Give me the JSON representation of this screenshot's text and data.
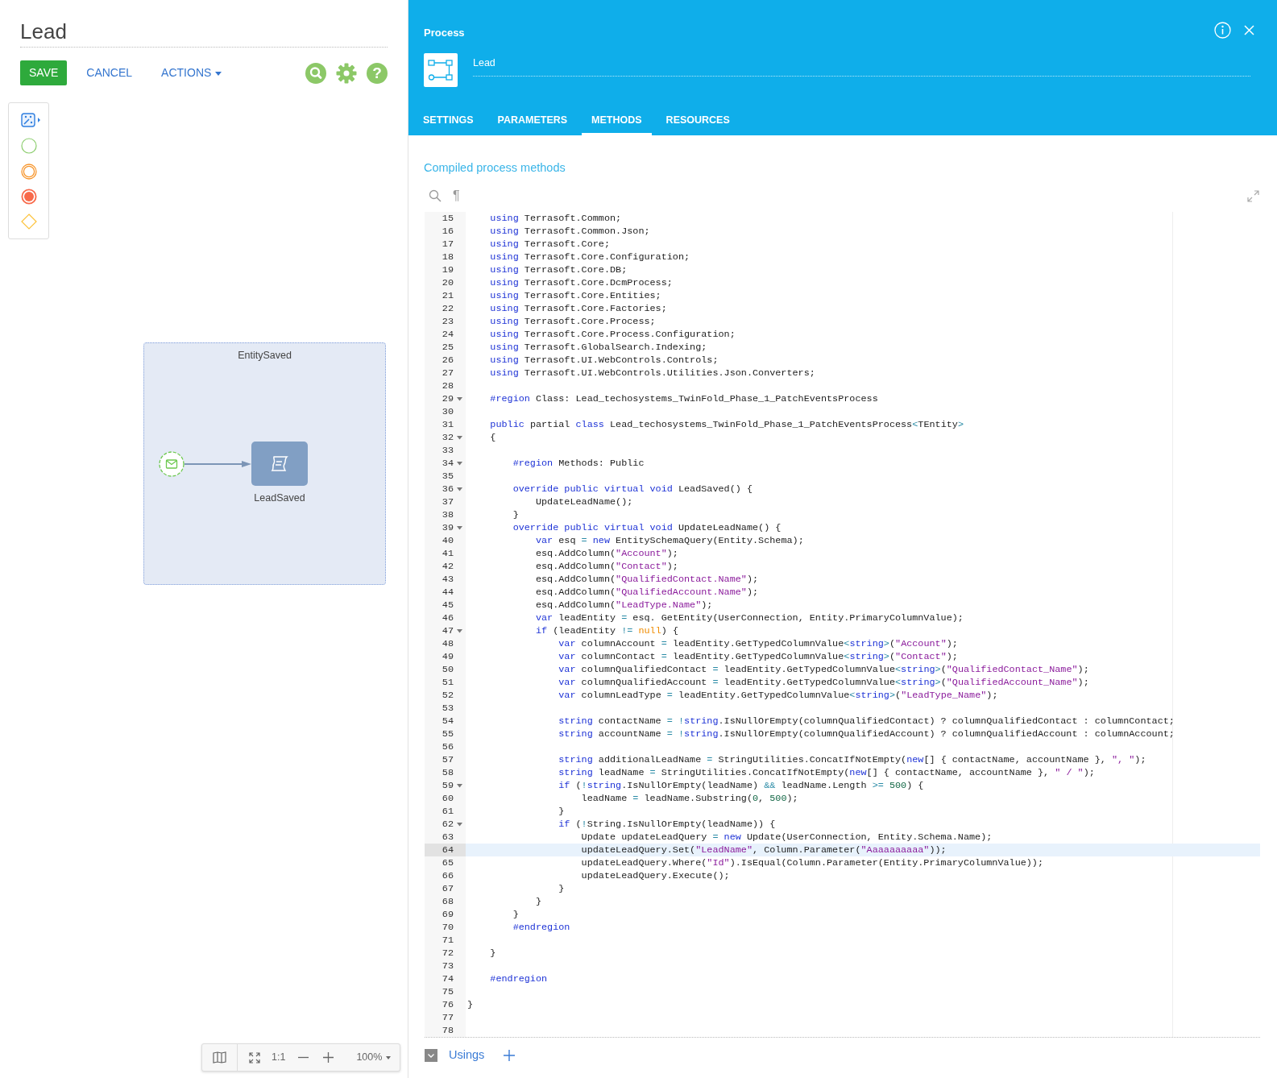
{
  "page": {
    "title": "Lead"
  },
  "toolbar": {
    "buttons": [
      {
        "label": "SAVE",
        "kind": "primary"
      },
      {
        "label": "CANCEL",
        "kind": "link"
      },
      {
        "label": "ACTIONS",
        "kind": "dropdown"
      }
    ],
    "help": "?"
  },
  "diagram": {
    "lane": {
      "label": "EntitySaved"
    },
    "task": {
      "label": "LeadSaved"
    }
  },
  "zoom_bar": {
    "actual_size": "1:1",
    "zoom": "100%"
  },
  "process_panel": {
    "title": "Process",
    "name": "Lead",
    "tabs": [
      {
        "label": "SETTINGS",
        "selected": false
      },
      {
        "label": "PARAMETERS",
        "selected": false
      },
      {
        "label": "METHODS",
        "selected": true
      },
      {
        "label": "RESOURCES",
        "selected": false
      }
    ],
    "section_title": "Compiled process methods",
    "format_marks": "¶",
    "editor": {
      "lines": [
        {
          "num": "15",
          "foldable": false,
          "current": false,
          "parts": [
            {
              "kind": "keyword",
              "text": "    using"
            },
            {
              "kind": "plain",
              "text": " Terrasoft.Common;"
            }
          ]
        },
        {
          "num": "16",
          "foldable": false,
          "current": false,
          "parts": [
            {
              "kind": "keyword",
              "text": "    using"
            },
            {
              "kind": "plain",
              "text": " Terrasoft.Common.Json;"
            }
          ]
        },
        {
          "num": "17",
          "foldable": false,
          "current": false,
          "parts": [
            {
              "kind": "keyword",
              "text": "    using"
            },
            {
              "kind": "plain",
              "text": " Terrasoft.Core;"
            }
          ]
        },
        {
          "num": "18",
          "foldable": false,
          "current": false,
          "parts": [
            {
              "kind": "keyword",
              "text": "    using"
            },
            {
              "kind": "plain",
              "text": " Terrasoft.Core.Configuration;"
            }
          ]
        },
        {
          "num": "19",
          "foldable": false,
          "current": false,
          "parts": [
            {
              "kind": "keyword",
              "text": "    using"
            },
            {
              "kind": "plain",
              "text": " Terrasoft.Core.DB;"
            }
          ]
        },
        {
          "num": "20",
          "foldable": false,
          "current": false,
          "parts": [
            {
              "kind": "keyword",
              "text": "    using"
            },
            {
              "kind": "plain",
              "text": " Terrasoft.Core.DcmProcess;"
            }
          ]
        },
        {
          "num": "21",
          "foldable": false,
          "current": false,
          "parts": [
            {
              "kind": "keyword",
              "text": "    using"
            },
            {
              "kind": "plain",
              "text": " Terrasoft.Core.Entities;"
            }
          ]
        },
        {
          "num": "22",
          "foldable": false,
          "current": false,
          "parts": [
            {
              "kind": "keyword",
              "text": "    using"
            },
            {
              "kind": "plain",
              "text": " Terrasoft.Core.Factories;"
            }
          ]
        },
        {
          "num": "23",
          "foldable": false,
          "current": false,
          "parts": [
            {
              "kind": "keyword",
              "text": "    using"
            },
            {
              "kind": "plain",
              "text": " Terrasoft.Core.Process;"
            }
          ]
        },
        {
          "num": "24",
          "foldable": false,
          "current": false,
          "parts": [
            {
              "kind": "keyword",
              "text": "    using"
            },
            {
              "kind": "plain",
              "text": " Terrasoft.Core.Process.Configuration;"
            }
          ]
        },
        {
          "num": "25",
          "foldable": false,
          "current": false,
          "parts": [
            {
              "kind": "keyword",
              "text": "    using"
            },
            {
              "kind": "plain",
              "text": " Terrasoft.GlobalSearch.Indexing;"
            }
          ]
        },
        {
          "num": "26",
          "foldable": false,
          "current": false,
          "parts": [
            {
              "kind": "keyword",
              "text": "    using"
            },
            {
              "kind": "plain",
              "text": " Terrasoft.UI.WebControls.Controls;"
            }
          ]
        },
        {
          "num": "27",
          "foldable": false,
          "current": false,
          "parts": [
            {
              "kind": "keyword",
              "text": "    using"
            },
            {
              "kind": "plain",
              "text": " Terrasoft.UI.WebControls.Utilities.Json.Converters;"
            }
          ]
        },
        {
          "num": "28",
          "foldable": false,
          "current": false
        },
        {
          "num": "29",
          "foldable": true,
          "current": false,
          "parts": [
            {
              "kind": "keyword",
              "text": "    #region"
            },
            {
              "kind": "plain",
              "text": " Class: Lead_techosystems_TwinFold_Phase_1_PatchEventsProcess"
            }
          ]
        },
        {
          "num": "30",
          "foldable": false,
          "current": false
        },
        {
          "num": "31",
          "foldable": false,
          "current": false,
          "parts": [
            {
              "kind": "keyword",
              "text": "    public"
            },
            {
              "kind": "plain",
              "text": " partial "
            },
            {
              "kind": "keyword",
              "text": "class"
            },
            {
              "kind": "plain",
              "text": " Lead_techosystems_TwinFold_Phase_1_PatchEventsProcess"
            },
            {
              "kind": "operator",
              "text": "<"
            },
            {
              "kind": "plain",
              "text": "TEntity"
            },
            {
              "kind": "operator",
              "text": ">"
            }
          ]
        },
        {
          "num": "32",
          "foldable": true,
          "current": false,
          "parts": [
            {
              "kind": "plain",
              "text": "    {"
            }
          ]
        },
        {
          "num": "33",
          "foldable": false,
          "current": false
        },
        {
          "num": "34",
          "foldable": true,
          "current": false,
          "parts": [
            {
              "kind": "keyword",
              "text": "        #region"
            },
            {
              "kind": "plain",
              "text": " Methods: Public"
            }
          ]
        },
        {
          "num": "35",
          "foldable": false,
          "current": false
        },
        {
          "num": "36",
          "foldable": true,
          "current": false,
          "parts": [
            {
              "kind": "keyword",
              "text": "        override public virtual void"
            },
            {
              "kind": "plain",
              "text": " LeadSaved() {"
            }
          ]
        },
        {
          "num": "37",
          "foldable": false,
          "current": false,
          "parts": [
            {
              "kind": "plain",
              "text": "            UpdateLeadName();"
            }
          ]
        },
        {
          "num": "38",
          "foldable": false,
          "current": false,
          "parts": [
            {
              "kind": "plain",
              "text": "        }"
            }
          ]
        },
        {
          "num": "39",
          "foldable": true,
          "current": false,
          "parts": [
            {
              "kind": "keyword",
              "text": "        override public virtual void"
            },
            {
              "kind": "plain",
              "text": " UpdateLeadName() {"
            }
          ]
        },
        {
          "num": "40",
          "foldable": false,
          "current": false,
          "parts": [
            {
              "kind": "keyword",
              "text": "            var"
            },
            {
              "kind": "plain",
              "text": " esq "
            },
            {
              "kind": "operator",
              "text": "="
            },
            {
              "kind": "keyword",
              "text": " new"
            },
            {
              "kind": "plain",
              "text": " EntitySchemaQuery(Entity.Schema);"
            }
          ]
        },
        {
          "num": "41",
          "foldable": false,
          "current": false,
          "parts": [
            {
              "kind": "plain",
              "text": "            esq.AddColumn("
            },
            {
              "kind": "string",
              "text": "\"Account\""
            },
            {
              "kind": "plain",
              "text": ");"
            }
          ]
        },
        {
          "num": "42",
          "foldable": false,
          "current": false,
          "parts": [
            {
              "kind": "plain",
              "text": "            esq.AddColumn("
            },
            {
              "kind": "string",
              "text": "\"Contact\""
            },
            {
              "kind": "plain",
              "text": ");"
            }
          ]
        },
        {
          "num": "43",
          "foldable": false,
          "current": false,
          "parts": [
            {
              "kind": "plain",
              "text": "            esq.AddColumn("
            },
            {
              "kind": "string",
              "text": "\"QualifiedContact.Name\""
            },
            {
              "kind": "plain",
              "text": ");"
            }
          ]
        },
        {
          "num": "44",
          "foldable": false,
          "current": false,
          "parts": [
            {
              "kind": "plain",
              "text": "            esq.AddColumn("
            },
            {
              "kind": "string",
              "text": "\"QualifiedAccount.Name\""
            },
            {
              "kind": "plain",
              "text": ");"
            }
          ]
        },
        {
          "num": "45",
          "foldable": false,
          "current": false,
          "parts": [
            {
              "kind": "plain",
              "text": "            esq.AddColumn("
            },
            {
              "kind": "string",
              "text": "\"LeadType.Name\""
            },
            {
              "kind": "plain",
              "text": ");"
            }
          ]
        },
        {
          "num": "46",
          "foldable": false,
          "current": false,
          "parts": [
            {
              "kind": "keyword",
              "text": "            var"
            },
            {
              "kind": "plain",
              "text": " leadEntity "
            },
            {
              "kind": "operator",
              "text": "="
            },
            {
              "kind": "plain",
              "text": " esq. GetEntity(UserConnection, Entity.PrimaryColumnValue);"
            }
          ]
        },
        {
          "num": "47",
          "foldable": true,
          "current": false,
          "parts": [
            {
              "kind": "keyword",
              "text": "            if"
            },
            {
              "kind": "plain",
              "text": " (leadEntity "
            },
            {
              "kind": "operator",
              "text": "!="
            },
            {
              "kind": "literal",
              "text": " null"
            },
            {
              "kind": "plain",
              "text": ") {"
            }
          ]
        },
        {
          "num": "48",
          "foldable": false,
          "current": false,
          "parts": [
            {
              "kind": "keyword",
              "text": "                var"
            },
            {
              "kind": "plain",
              "text": " columnAccount "
            },
            {
              "kind": "operator",
              "text": "="
            },
            {
              "kind": "plain",
              "text": " leadEntity.GetTypedColumnValue"
            },
            {
              "kind": "operator",
              "text": "<"
            },
            {
              "kind": "keyword",
              "text": "string"
            },
            {
              "kind": "operator",
              "text": ">"
            },
            {
              "kind": "plain",
              "text": "("
            },
            {
              "kind": "string",
              "text": "\"Account\""
            },
            {
              "kind": "plain",
              "text": ");"
            }
          ]
        },
        {
          "num": "49",
          "foldable": false,
          "current": false,
          "parts": [
            {
              "kind": "keyword",
              "text": "                var"
            },
            {
              "kind": "plain",
              "text": " columnContact "
            },
            {
              "kind": "operator",
              "text": "="
            },
            {
              "kind": "plain",
              "text": " leadEntity.GetTypedColumnValue"
            },
            {
              "kind": "operator",
              "text": "<"
            },
            {
              "kind": "keyword",
              "text": "string"
            },
            {
              "kind": "operator",
              "text": ">"
            },
            {
              "kind": "plain",
              "text": "("
            },
            {
              "kind": "string",
              "text": "\"Contact\""
            },
            {
              "kind": "plain",
              "text": ");"
            }
          ]
        },
        {
          "num": "50",
          "foldable": false,
          "current": false,
          "parts": [
            {
              "kind": "keyword",
              "text": "                var"
            },
            {
              "kind": "plain",
              "text": " columnQualifiedContact "
            },
            {
              "kind": "operator",
              "text": "="
            },
            {
              "kind": "plain",
              "text": " leadEntity.GetTypedColumnValue"
            },
            {
              "kind": "operator",
              "text": "<"
            },
            {
              "kind": "keyword",
              "text": "string"
            },
            {
              "kind": "operator",
              "text": ">"
            },
            {
              "kind": "plain",
              "text": "("
            },
            {
              "kind": "string",
              "text": "\"QualifiedContact_Name\""
            },
            {
              "kind": "plain",
              "text": ");"
            }
          ]
        },
        {
          "num": "51",
          "foldable": false,
          "current": false,
          "parts": [
            {
              "kind": "keyword",
              "text": "                var"
            },
            {
              "kind": "plain",
              "text": " columnQualifiedAccount "
            },
            {
              "kind": "operator",
              "text": "="
            },
            {
              "kind": "plain",
              "text": " leadEntity.GetTypedColumnValue"
            },
            {
              "kind": "operator",
              "text": "<"
            },
            {
              "kind": "keyword",
              "text": "string"
            },
            {
              "kind": "operator",
              "text": ">"
            },
            {
              "kind": "plain",
              "text": "("
            },
            {
              "kind": "string",
              "text": "\"QualifiedAccount_Name\""
            },
            {
              "kind": "plain",
              "text": ");"
            }
          ]
        },
        {
          "num": "52",
          "foldable": false,
          "current": false,
          "parts": [
            {
              "kind": "keyword",
              "text": "                var"
            },
            {
              "kind": "plain",
              "text": " columnLeadType "
            },
            {
              "kind": "operator",
              "text": "="
            },
            {
              "kind": "plain",
              "text": " leadEntity.GetTypedColumnValue"
            },
            {
              "kind": "operator",
              "text": "<"
            },
            {
              "kind": "keyword",
              "text": "string"
            },
            {
              "kind": "operator",
              "text": ">"
            },
            {
              "kind": "plain",
              "text": "("
            },
            {
              "kind": "string",
              "text": "\"LeadType_Name\""
            },
            {
              "kind": "plain",
              "text": ");"
            }
          ]
        },
        {
          "num": "53",
          "foldable": false,
          "current": false
        },
        {
          "num": "54",
          "foldable": false,
          "current": false,
          "parts": [
            {
              "kind": "keyword",
              "text": "                string"
            },
            {
              "kind": "plain",
              "text": " contactName "
            },
            {
              "kind": "operator",
              "text": "="
            },
            {
              "kind": "operator",
              "text": " !"
            },
            {
              "kind": "keyword",
              "text": "string"
            },
            {
              "kind": "plain",
              "text": ".IsNullOrEmpty(columnQualifiedContact) ? columnQualifiedContact : columnContact;"
            }
          ]
        },
        {
          "num": "55",
          "foldable": false,
          "current": false,
          "parts": [
            {
              "kind": "keyword",
              "text": "                string"
            },
            {
              "kind": "plain",
              "text": " accountName "
            },
            {
              "kind": "operator",
              "text": "="
            },
            {
              "kind": "operator",
              "text": " !"
            },
            {
              "kind": "keyword",
              "text": "string"
            },
            {
              "kind": "plain",
              "text": ".IsNullOrEmpty(columnQualifiedAccount) ? columnQualifiedAccount : columnAccount;"
            }
          ]
        },
        {
          "num": "56",
          "foldable": false,
          "current": false
        },
        {
          "num": "57",
          "foldable": false,
          "current": false,
          "parts": [
            {
              "kind": "keyword",
              "text": "                string"
            },
            {
              "kind": "plain",
              "text": " additionalLeadName "
            },
            {
              "kind": "operator",
              "text": "="
            },
            {
              "kind": "plain",
              "text": " StringUtilities.ConcatIfNotEmpty("
            },
            {
              "kind": "keyword",
              "text": "new"
            },
            {
              "kind": "plain",
              "text": "[] { contactName, accountName }, "
            },
            {
              "kind": "string",
              "text": "\", \""
            },
            {
              "kind": "plain",
              "text": ");"
            }
          ]
        },
        {
          "num": "58",
          "foldable": false,
          "current": false,
          "parts": [
            {
              "kind": "keyword",
              "text": "                string"
            },
            {
              "kind": "plain",
              "text": " leadName "
            },
            {
              "kind": "operator",
              "text": "="
            },
            {
              "kind": "plain",
              "text": " StringUtilities.ConcatIfNotEmpty("
            },
            {
              "kind": "keyword",
              "text": "new"
            },
            {
              "kind": "plain",
              "text": "[] { contactName, accountName }, "
            },
            {
              "kind": "string",
              "text": "\" / \""
            },
            {
              "kind": "plain",
              "text": ");"
            }
          ]
        },
        {
          "num": "59",
          "foldable": true,
          "current": false,
          "parts": [
            {
              "kind": "keyword",
              "text": "                if"
            },
            {
              "kind": "plain",
              "text": " ("
            },
            {
              "kind": "operator",
              "text": "!"
            },
            {
              "kind": "keyword",
              "text": "string"
            },
            {
              "kind": "plain",
              "text": ".IsNullOrEmpty(leadName) "
            },
            {
              "kind": "operator",
              "text": "&&"
            },
            {
              "kind": "plain",
              "text": " leadName.Length "
            },
            {
              "kind": "operator",
              "text": ">="
            },
            {
              "kind": "number",
              "text": " 500"
            },
            {
              "kind": "plain",
              "text": ") {"
            }
          ]
        },
        {
          "num": "60",
          "foldable": false,
          "current": false,
          "parts": [
            {
              "kind": "plain",
              "text": "                    leadName "
            },
            {
              "kind": "operator",
              "text": "="
            },
            {
              "kind": "plain",
              "text": " leadName.Substring("
            },
            {
              "kind": "number",
              "text": "0"
            },
            {
              "kind": "plain",
              "text": ", "
            },
            {
              "kind": "number",
              "text": "500"
            },
            {
              "kind": "plain",
              "text": ");"
            }
          ]
        },
        {
          "num": "61",
          "foldable": false,
          "current": false,
          "parts": [
            {
              "kind": "plain",
              "text": "                }"
            }
          ]
        },
        {
          "num": "62",
          "foldable": true,
          "current": false,
          "parts": [
            {
              "kind": "keyword",
              "text": "                if"
            },
            {
              "kind": "plain",
              "text": " ("
            },
            {
              "kind": "operator",
              "text": "!"
            },
            {
              "kind": "plain",
              "text": "String.IsNullOrEmpty(leadName)) {"
            }
          ]
        },
        {
          "num": "63",
          "foldable": false,
          "current": false,
          "parts": [
            {
              "kind": "plain",
              "text": "                    Update updateLeadQuery "
            },
            {
              "kind": "operator",
              "text": "="
            },
            {
              "kind": "keyword",
              "text": " new"
            },
            {
              "kind": "plain",
              "text": " Update(UserConnection, Entity.Schema.Name);"
            }
          ]
        },
        {
          "num": "64",
          "foldable": false,
          "current": true,
          "parts": [
            {
              "kind": "plain",
              "text": "                    updateLeadQuery.Set("
            },
            {
              "kind": "string",
              "text": "\"LeadName\""
            },
            {
              "kind": "plain",
              "text": ", Column.Parameter("
            },
            {
              "kind": "string",
              "text": "\"Aaaaaaaaaa\""
            },
            {
              "kind": "plain",
              "text": "));"
            }
          ]
        },
        {
          "num": "65",
          "foldable": false,
          "current": false,
          "parts": [
            {
              "kind": "plain",
              "text": "                    updateLeadQuery.Where("
            },
            {
              "kind": "string",
              "text": "\"Id\""
            },
            {
              "kind": "plain",
              "text": ").IsEqual(Column.Parameter(Entity.PrimaryColumnValue));"
            }
          ]
        },
        {
          "num": "66",
          "foldable": false,
          "current": false,
          "parts": [
            {
              "kind": "plain",
              "text": "                    updateLeadQuery.Execute();"
            }
          ]
        },
        {
          "num": "67",
          "foldable": false,
          "current": false,
          "parts": [
            {
              "kind": "plain",
              "text": "                }"
            }
          ]
        },
        {
          "num": "68",
          "foldable": false,
          "current": false,
          "parts": [
            {
              "kind": "plain",
              "text": "            }"
            }
          ]
        },
        {
          "num": "69",
          "foldable": false,
          "current": false,
          "parts": [
            {
              "kind": "plain",
              "text": "        }"
            }
          ]
        },
        {
          "num": "70",
          "foldable": false,
          "current": false,
          "parts": [
            {
              "kind": "keyword",
              "text": "        #endregion"
            }
          ]
        },
        {
          "num": "71",
          "foldable": false,
          "current": false
        },
        {
          "num": "72",
          "foldable": false,
          "current": false,
          "parts": [
            {
              "kind": "plain",
              "text": "    }"
            }
          ]
        },
        {
          "num": "73",
          "foldable": false,
          "current": false
        },
        {
          "num": "74",
          "foldable": false,
          "current": false,
          "parts": [
            {
              "kind": "keyword",
              "text": "    #endregion"
            }
          ]
        },
        {
          "num": "75",
          "foldable": false,
          "current": false
        },
        {
          "num": "76",
          "foldable": false,
          "current": false,
          "parts": [
            {
              "kind": "plain",
              "text": "}"
            }
          ]
        },
        {
          "num": "77",
          "foldable": false,
          "current": false
        },
        {
          "num": "78",
          "foldable": false,
          "current": false
        }
      ]
    },
    "footer": {
      "usings_label": "Usings"
    }
  }
}
